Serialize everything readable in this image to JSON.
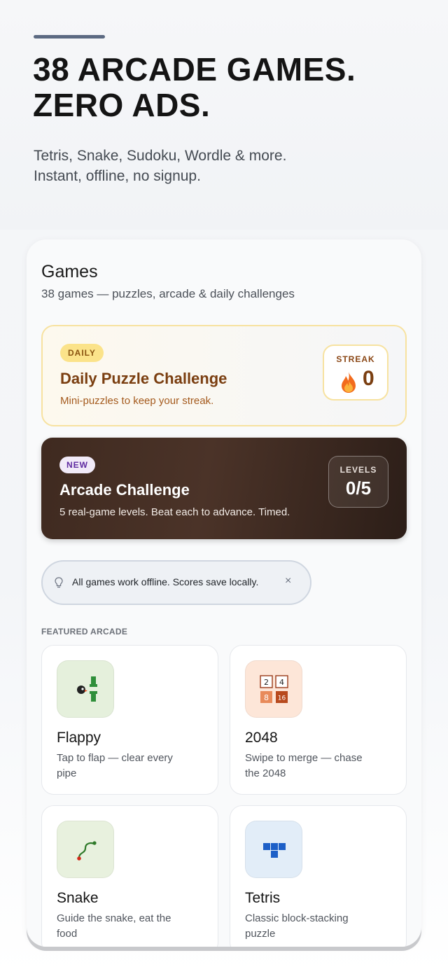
{
  "hero": {
    "title_line1": "38 ARCADE GAMES.",
    "title_line2": "ZERO ADS.",
    "subtitle_line1": "Tetris, Snake, Sudoku, Wordle & more.",
    "subtitle_line2": "Instant, offline, no signup."
  },
  "games": {
    "title": "Games",
    "subtitle": "38 games — puzzles, arcade & daily challenges"
  },
  "daily": {
    "badge": "DAILY",
    "title": "Daily Puzzle Challenge",
    "subtitle": "Mini-puzzles to keep your streak.",
    "streak_label": "STREAK",
    "streak_value": "0",
    "streak_icon": "flame-icon"
  },
  "arcade": {
    "badge": "NEW",
    "title": "Arcade Challenge",
    "subtitle": "5 real-game levels. Beat each to advance. Timed.",
    "levels_label": "LEVELS",
    "levels_value": "0/5"
  },
  "tip": {
    "icon": "lightbulb-icon",
    "text": "All games work offline. Scores save locally.",
    "close": "×"
  },
  "featured": {
    "label": "FEATURED ARCADE",
    "cards": [
      {
        "title": "Flappy",
        "desc": "Tap to flap — clear every pipe",
        "icon": "flappy-bird-icon"
      },
      {
        "title": "2048",
        "desc": "Swipe to merge — chase the 2048",
        "icon": "tiles-2048-icon",
        "tiles": [
          "2",
          "4",
          "8",
          "16"
        ]
      },
      {
        "title": "Snake",
        "desc": "Guide the snake, eat the food",
        "icon": "snake-icon"
      },
      {
        "title": "Tetris",
        "desc": "Classic block-stacking puzzle",
        "icon": "tetris-icon"
      }
    ]
  },
  "colors": {
    "daily_accent": "#7a3e10",
    "arcade_bg": "#3f2a20",
    "badge_new": "#5e2aa0"
  }
}
